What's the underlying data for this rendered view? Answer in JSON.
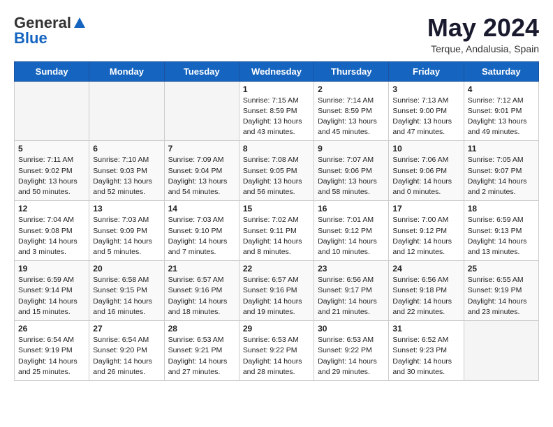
{
  "header": {
    "logo": {
      "general": "General",
      "blue": "Blue"
    },
    "title": "May 2024",
    "location": "Terque, Andalusia, Spain"
  },
  "weekdays": [
    "Sunday",
    "Monday",
    "Tuesday",
    "Wednesday",
    "Thursday",
    "Friday",
    "Saturday"
  ],
  "weeks": [
    [
      {
        "day": "",
        "sunrise": "",
        "sunset": "",
        "daylight": ""
      },
      {
        "day": "",
        "sunrise": "",
        "sunset": "",
        "daylight": ""
      },
      {
        "day": "",
        "sunrise": "",
        "sunset": "",
        "daylight": ""
      },
      {
        "day": "1",
        "sunrise": "Sunrise: 7:15 AM",
        "sunset": "Sunset: 8:59 PM",
        "daylight": "Daylight: 13 hours and 43 minutes."
      },
      {
        "day": "2",
        "sunrise": "Sunrise: 7:14 AM",
        "sunset": "Sunset: 8:59 PM",
        "daylight": "Daylight: 13 hours and 45 minutes."
      },
      {
        "day": "3",
        "sunrise": "Sunrise: 7:13 AM",
        "sunset": "Sunset: 9:00 PM",
        "daylight": "Daylight: 13 hours and 47 minutes."
      },
      {
        "day": "4",
        "sunrise": "Sunrise: 7:12 AM",
        "sunset": "Sunset: 9:01 PM",
        "daylight": "Daylight: 13 hours and 49 minutes."
      }
    ],
    [
      {
        "day": "5",
        "sunrise": "Sunrise: 7:11 AM",
        "sunset": "Sunset: 9:02 PM",
        "daylight": "Daylight: 13 hours and 50 minutes."
      },
      {
        "day": "6",
        "sunrise": "Sunrise: 7:10 AM",
        "sunset": "Sunset: 9:03 PM",
        "daylight": "Daylight: 13 hours and 52 minutes."
      },
      {
        "day": "7",
        "sunrise": "Sunrise: 7:09 AM",
        "sunset": "Sunset: 9:04 PM",
        "daylight": "Daylight: 13 hours and 54 minutes."
      },
      {
        "day": "8",
        "sunrise": "Sunrise: 7:08 AM",
        "sunset": "Sunset: 9:05 PM",
        "daylight": "Daylight: 13 hours and 56 minutes."
      },
      {
        "day": "9",
        "sunrise": "Sunrise: 7:07 AM",
        "sunset": "Sunset: 9:06 PM",
        "daylight": "Daylight: 13 hours and 58 minutes."
      },
      {
        "day": "10",
        "sunrise": "Sunrise: 7:06 AM",
        "sunset": "Sunset: 9:06 PM",
        "daylight": "Daylight: 14 hours and 0 minutes."
      },
      {
        "day": "11",
        "sunrise": "Sunrise: 7:05 AM",
        "sunset": "Sunset: 9:07 PM",
        "daylight": "Daylight: 14 hours and 2 minutes."
      }
    ],
    [
      {
        "day": "12",
        "sunrise": "Sunrise: 7:04 AM",
        "sunset": "Sunset: 9:08 PM",
        "daylight": "Daylight: 14 hours and 3 minutes."
      },
      {
        "day": "13",
        "sunrise": "Sunrise: 7:03 AM",
        "sunset": "Sunset: 9:09 PM",
        "daylight": "Daylight: 14 hours and 5 minutes."
      },
      {
        "day": "14",
        "sunrise": "Sunrise: 7:03 AM",
        "sunset": "Sunset: 9:10 PM",
        "daylight": "Daylight: 14 hours and 7 minutes."
      },
      {
        "day": "15",
        "sunrise": "Sunrise: 7:02 AM",
        "sunset": "Sunset: 9:11 PM",
        "daylight": "Daylight: 14 hours and 8 minutes."
      },
      {
        "day": "16",
        "sunrise": "Sunrise: 7:01 AM",
        "sunset": "Sunset: 9:12 PM",
        "daylight": "Daylight: 14 hours and 10 minutes."
      },
      {
        "day": "17",
        "sunrise": "Sunrise: 7:00 AM",
        "sunset": "Sunset: 9:12 PM",
        "daylight": "Daylight: 14 hours and 12 minutes."
      },
      {
        "day": "18",
        "sunrise": "Sunrise: 6:59 AM",
        "sunset": "Sunset: 9:13 PM",
        "daylight": "Daylight: 14 hours and 13 minutes."
      }
    ],
    [
      {
        "day": "19",
        "sunrise": "Sunrise: 6:59 AM",
        "sunset": "Sunset: 9:14 PM",
        "daylight": "Daylight: 14 hours and 15 minutes."
      },
      {
        "day": "20",
        "sunrise": "Sunrise: 6:58 AM",
        "sunset": "Sunset: 9:15 PM",
        "daylight": "Daylight: 14 hours and 16 minutes."
      },
      {
        "day": "21",
        "sunrise": "Sunrise: 6:57 AM",
        "sunset": "Sunset: 9:16 PM",
        "daylight": "Daylight: 14 hours and 18 minutes."
      },
      {
        "day": "22",
        "sunrise": "Sunrise: 6:57 AM",
        "sunset": "Sunset: 9:16 PM",
        "daylight": "Daylight: 14 hours and 19 minutes."
      },
      {
        "day": "23",
        "sunrise": "Sunrise: 6:56 AM",
        "sunset": "Sunset: 9:17 PM",
        "daylight": "Daylight: 14 hours and 21 minutes."
      },
      {
        "day": "24",
        "sunrise": "Sunrise: 6:56 AM",
        "sunset": "Sunset: 9:18 PM",
        "daylight": "Daylight: 14 hours and 22 minutes."
      },
      {
        "day": "25",
        "sunrise": "Sunrise: 6:55 AM",
        "sunset": "Sunset: 9:19 PM",
        "daylight": "Daylight: 14 hours and 23 minutes."
      }
    ],
    [
      {
        "day": "26",
        "sunrise": "Sunrise: 6:54 AM",
        "sunset": "Sunset: 9:19 PM",
        "daylight": "Daylight: 14 hours and 25 minutes."
      },
      {
        "day": "27",
        "sunrise": "Sunrise: 6:54 AM",
        "sunset": "Sunset: 9:20 PM",
        "daylight": "Daylight: 14 hours and 26 minutes."
      },
      {
        "day": "28",
        "sunrise": "Sunrise: 6:53 AM",
        "sunset": "Sunset: 9:21 PM",
        "daylight": "Daylight: 14 hours and 27 minutes."
      },
      {
        "day": "29",
        "sunrise": "Sunrise: 6:53 AM",
        "sunset": "Sunset: 9:22 PM",
        "daylight": "Daylight: 14 hours and 28 minutes."
      },
      {
        "day": "30",
        "sunrise": "Sunrise: 6:53 AM",
        "sunset": "Sunset: 9:22 PM",
        "daylight": "Daylight: 14 hours and 29 minutes."
      },
      {
        "day": "31",
        "sunrise": "Sunrise: 6:52 AM",
        "sunset": "Sunset: 9:23 PM",
        "daylight": "Daylight: 14 hours and 30 minutes."
      },
      {
        "day": "",
        "sunrise": "",
        "sunset": "",
        "daylight": ""
      }
    ]
  ]
}
